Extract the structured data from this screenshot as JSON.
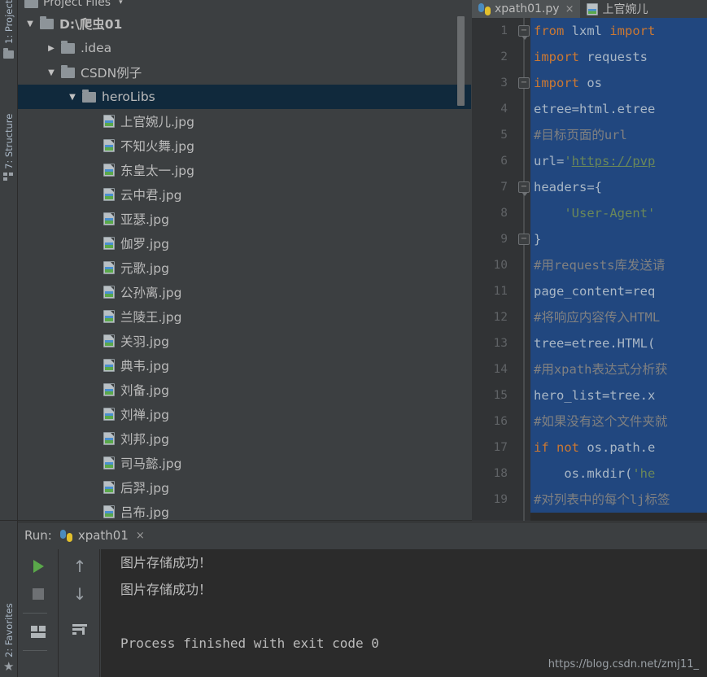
{
  "window": {
    "left_tool_tabs": [
      {
        "label": "1: Project",
        "icon": "folder-icon"
      },
      {
        "label": "7: Structure",
        "icon": "structure-icon"
      },
      {
        "label": "2: Favorites",
        "icon": "star-icon"
      }
    ]
  },
  "toolbar": {
    "icons": [
      "stop-circle-icon",
      "caret-up-icon",
      "divider",
      "gear-icon",
      "minimize-icon"
    ]
  },
  "project_panel": {
    "title": "Project Files",
    "caret": "▾",
    "tree": [
      {
        "indent": 0,
        "arrow": "▼",
        "icon": "folder-icon",
        "label": "D:\\爬虫01",
        "bold": true,
        "selected": false
      },
      {
        "indent": 1,
        "arrow": "▶",
        "icon": "folder-icon",
        "label": ".idea",
        "bold": false,
        "selected": false
      },
      {
        "indent": 1,
        "arrow": "▼",
        "icon": "folder-icon",
        "label": "CSDN例子",
        "bold": false,
        "selected": false
      },
      {
        "indent": 2,
        "arrow": "▼",
        "icon": "folder-icon",
        "label": "heroLibs",
        "bold": false,
        "selected": true
      },
      {
        "indent": 3,
        "arrow": "",
        "icon": "image-file-icon",
        "label": "上官婉儿.jpg",
        "bold": false,
        "selected": false
      },
      {
        "indent": 3,
        "arrow": "",
        "icon": "image-file-icon",
        "label": "不知火舞.jpg",
        "bold": false,
        "selected": false
      },
      {
        "indent": 3,
        "arrow": "",
        "icon": "image-file-icon",
        "label": "东皇太一.jpg",
        "bold": false,
        "selected": false
      },
      {
        "indent": 3,
        "arrow": "",
        "icon": "image-file-icon",
        "label": "云中君.jpg",
        "bold": false,
        "selected": false
      },
      {
        "indent": 3,
        "arrow": "",
        "icon": "image-file-icon",
        "label": "亚瑟.jpg",
        "bold": false,
        "selected": false
      },
      {
        "indent": 3,
        "arrow": "",
        "icon": "image-file-icon",
        "label": "伽罗.jpg",
        "bold": false,
        "selected": false
      },
      {
        "indent": 3,
        "arrow": "",
        "icon": "image-file-icon",
        "label": "元歌.jpg",
        "bold": false,
        "selected": false
      },
      {
        "indent": 3,
        "arrow": "",
        "icon": "image-file-icon",
        "label": "公孙离.jpg",
        "bold": false,
        "selected": false
      },
      {
        "indent": 3,
        "arrow": "",
        "icon": "image-file-icon",
        "label": "兰陵王.jpg",
        "bold": false,
        "selected": false
      },
      {
        "indent": 3,
        "arrow": "",
        "icon": "image-file-icon",
        "label": "关羽.jpg",
        "bold": false,
        "selected": false
      },
      {
        "indent": 3,
        "arrow": "",
        "icon": "image-file-icon",
        "label": "典韦.jpg",
        "bold": false,
        "selected": false
      },
      {
        "indent": 3,
        "arrow": "",
        "icon": "image-file-icon",
        "label": "刘备.jpg",
        "bold": false,
        "selected": false
      },
      {
        "indent": 3,
        "arrow": "",
        "icon": "image-file-icon",
        "label": "刘禅.jpg",
        "bold": false,
        "selected": false
      },
      {
        "indent": 3,
        "arrow": "",
        "icon": "image-file-icon",
        "label": "刘邦.jpg",
        "bold": false,
        "selected": false
      },
      {
        "indent": 3,
        "arrow": "",
        "icon": "image-file-icon",
        "label": "司马懿.jpg",
        "bold": false,
        "selected": false
      },
      {
        "indent": 3,
        "arrow": "",
        "icon": "image-file-icon",
        "label": "后羿.jpg",
        "bold": false,
        "selected": false
      },
      {
        "indent": 3,
        "arrow": "",
        "icon": "image-file-icon",
        "label": "吕布.jpg",
        "bold": false,
        "selected": false
      }
    ]
  },
  "editor": {
    "tabs": [
      {
        "label": "xpath01.py",
        "icon": "python-file-icon",
        "active": true,
        "close": "×"
      },
      {
        "label": "上官婉儿",
        "icon": "image-file-icon",
        "active": false,
        "close": ""
      }
    ],
    "lines": [
      {
        "n": "1",
        "fold": "collapse-arrow",
        "segments": [
          {
            "t": "from ",
            "c": "kw"
          },
          {
            "t": "lxml ",
            "c": "def"
          },
          {
            "t": "import",
            "c": "kw"
          }
        ]
      },
      {
        "n": "2",
        "fold": "",
        "segments": [
          {
            "t": "import ",
            "c": "kw"
          },
          {
            "t": "requests",
            "c": "def"
          }
        ]
      },
      {
        "n": "3",
        "fold": "collapse-box",
        "segments": [
          {
            "t": "import ",
            "c": "kw"
          },
          {
            "t": "os",
            "c": "def"
          }
        ]
      },
      {
        "n": "4",
        "fold": "",
        "segments": [
          {
            "t": "etree=html.etree",
            "c": "def"
          }
        ]
      },
      {
        "n": "5",
        "fold": "",
        "segments": [
          {
            "t": "#目标页面的url",
            "c": "cmt"
          }
        ]
      },
      {
        "n": "6",
        "fold": "",
        "segments": [
          {
            "t": "url=",
            "c": "def"
          },
          {
            "t": "'",
            "c": "str"
          },
          {
            "t": "https://pvp",
            "c": "link"
          }
        ]
      },
      {
        "n": "7",
        "fold": "collapse-arrow",
        "segments": [
          {
            "t": "headers={",
            "c": "def"
          }
        ]
      },
      {
        "n": "8",
        "fold": "",
        "segments": [
          {
            "t": "    'User-Agent'",
            "c": "str"
          }
        ]
      },
      {
        "n": "9",
        "fold": "collapse-box",
        "segments": [
          {
            "t": "}",
            "c": "def"
          }
        ]
      },
      {
        "n": "10",
        "fold": "",
        "segments": [
          {
            "t": "#用requests库发送请",
            "c": "cmt"
          }
        ]
      },
      {
        "n": "11",
        "fold": "",
        "segments": [
          {
            "t": "page_content=req",
            "c": "def"
          }
        ]
      },
      {
        "n": "12",
        "fold": "",
        "segments": [
          {
            "t": "#将响应内容传入HTML",
            "c": "cmt"
          }
        ]
      },
      {
        "n": "13",
        "fold": "",
        "segments": [
          {
            "t": "tree=etree.HTML(",
            "c": "def"
          }
        ]
      },
      {
        "n": "14",
        "fold": "",
        "segments": [
          {
            "t": "#用xpath表达式分析获",
            "c": "cmt"
          }
        ]
      },
      {
        "n": "15",
        "fold": "",
        "segments": [
          {
            "t": "hero_list=tree.x",
            "c": "def"
          }
        ]
      },
      {
        "n": "16",
        "fold": "",
        "segments": [
          {
            "t": "#如果没有这个文件夹就",
            "c": "cmt"
          }
        ]
      },
      {
        "n": "17",
        "fold": "",
        "segments": [
          {
            "t": "if not ",
            "c": "kw"
          },
          {
            "t": "os.path.e",
            "c": "def"
          }
        ]
      },
      {
        "n": "18",
        "fold": "",
        "segments": [
          {
            "t": "    os.mkdir(",
            "c": "def"
          },
          {
            "t": "'he",
            "c": "str"
          }
        ]
      },
      {
        "n": "19",
        "fold": "",
        "segments": [
          {
            "t": "#对列表中的每个lj标签",
            "c": "cmt"
          }
        ]
      }
    ]
  },
  "run_panel": {
    "label": "Run:",
    "tab_label": "xpath01",
    "tab_close": "×",
    "tool_buttons": [
      {
        "name": "rerun-button",
        "icon": "play-icon"
      },
      {
        "name": "stop-button",
        "icon": "stop-icon"
      },
      {
        "name": "layout-button",
        "icon": "window-layout-icon"
      },
      {
        "name": "up-button",
        "icon": "arrow-up-icon"
      },
      {
        "name": "down-button",
        "icon": "arrow-down-icon"
      },
      {
        "name": "soft-wrap-button",
        "icon": "soft-wrap-icon"
      }
    ],
    "console_lines": [
      "图片存储成功！",
      "图片存储成功！",
      "",
      "Process finished with exit code 0"
    ],
    "watermark": "https://blog.csdn.net/zmj11_"
  },
  "colors": {
    "background": "#3c3f41",
    "editor_bg": "#2b2b2b",
    "selection_blue": "#21477f",
    "tree_selected": "#10293c",
    "keyword_orange": "#cc7832",
    "string_green": "#6a8759",
    "comment_gray": "#808080",
    "text": "#a9b7c6",
    "run_green": "#5aa84a"
  }
}
